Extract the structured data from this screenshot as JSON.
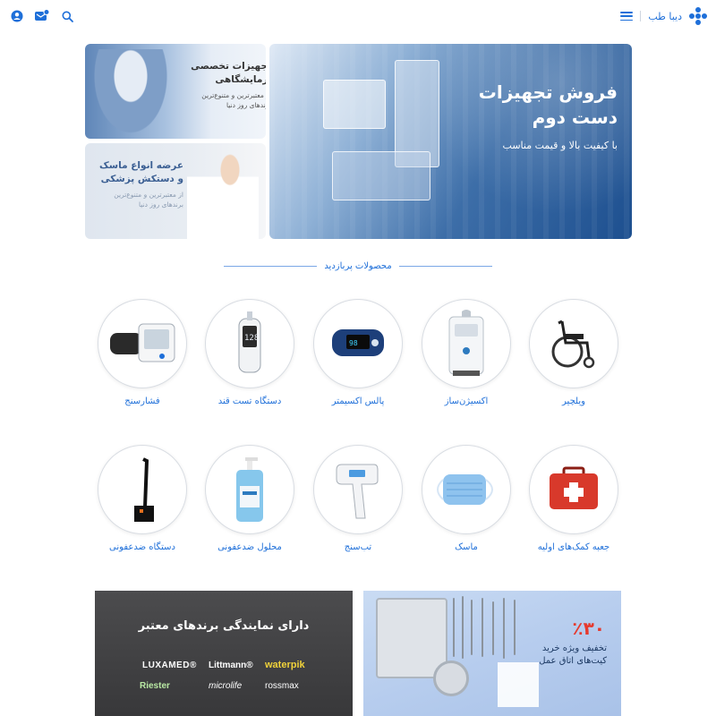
{
  "header": {
    "brand_name": "دیبا طب",
    "icons": [
      "account-icon",
      "messages-icon",
      "search-icon",
      "menu-icon"
    ]
  },
  "hero": {
    "main": {
      "title": "فروش تجهیزات دست دوم",
      "subtitle": "با کیفیت بالا و قیمت مناسب"
    },
    "lab": {
      "title": "تجهیزات تخصصی آزمایشگاهی",
      "subtitle": "از معتبرترین و متنوع‌ترین برندهای روز دنیا"
    },
    "mask": {
      "title": "عرضه انواع ماسک و دستکش پزشکی",
      "subtitle": "از معتبرترین و متنوع‌ترین برندهای روز دنیا"
    }
  },
  "section": {
    "title": "محصولات پربازدید"
  },
  "products": [
    {
      "label": "ویلچیر",
      "icon": "wheelchair-icon"
    },
    {
      "label": "اکسیژن‌ساز",
      "icon": "oxygen-concentrator-icon"
    },
    {
      "label": "پالس اکسیمتر",
      "icon": "pulse-oximeter-icon"
    },
    {
      "label": "دستگاه تست قند",
      "icon": "glucometer-icon"
    },
    {
      "label": "فشارسنج",
      "icon": "blood-pressure-monitor-icon"
    },
    {
      "label": "جعبه کمک‌های اولیه",
      "icon": "first-aid-kit-icon"
    },
    {
      "label": "ماسک",
      "icon": "mask-icon"
    },
    {
      "label": "تب‌سنج",
      "icon": "thermometer-icon"
    },
    {
      "label": "محلول ضدعفونی",
      "icon": "sanitizer-bottle-icon"
    },
    {
      "label": "دستگاه ضدعفونی",
      "icon": "sanitizer-stand-icon"
    }
  ],
  "brands_banner": {
    "title": "دارای نمایندگی برندهای معتبر",
    "brands": [
      "LUXAMED®",
      "Littmann®",
      "waterpik",
      "Riester",
      "microlife",
      "rossmax"
    ]
  },
  "kit_banner": {
    "discount": "٪۳۰",
    "text": "تخفیف ویژه خرید کیت‌های اتاق عمل"
  },
  "colors": {
    "accent": "#1e6fd9",
    "discount": "#e63a2e",
    "brands_bg": "#444446"
  }
}
